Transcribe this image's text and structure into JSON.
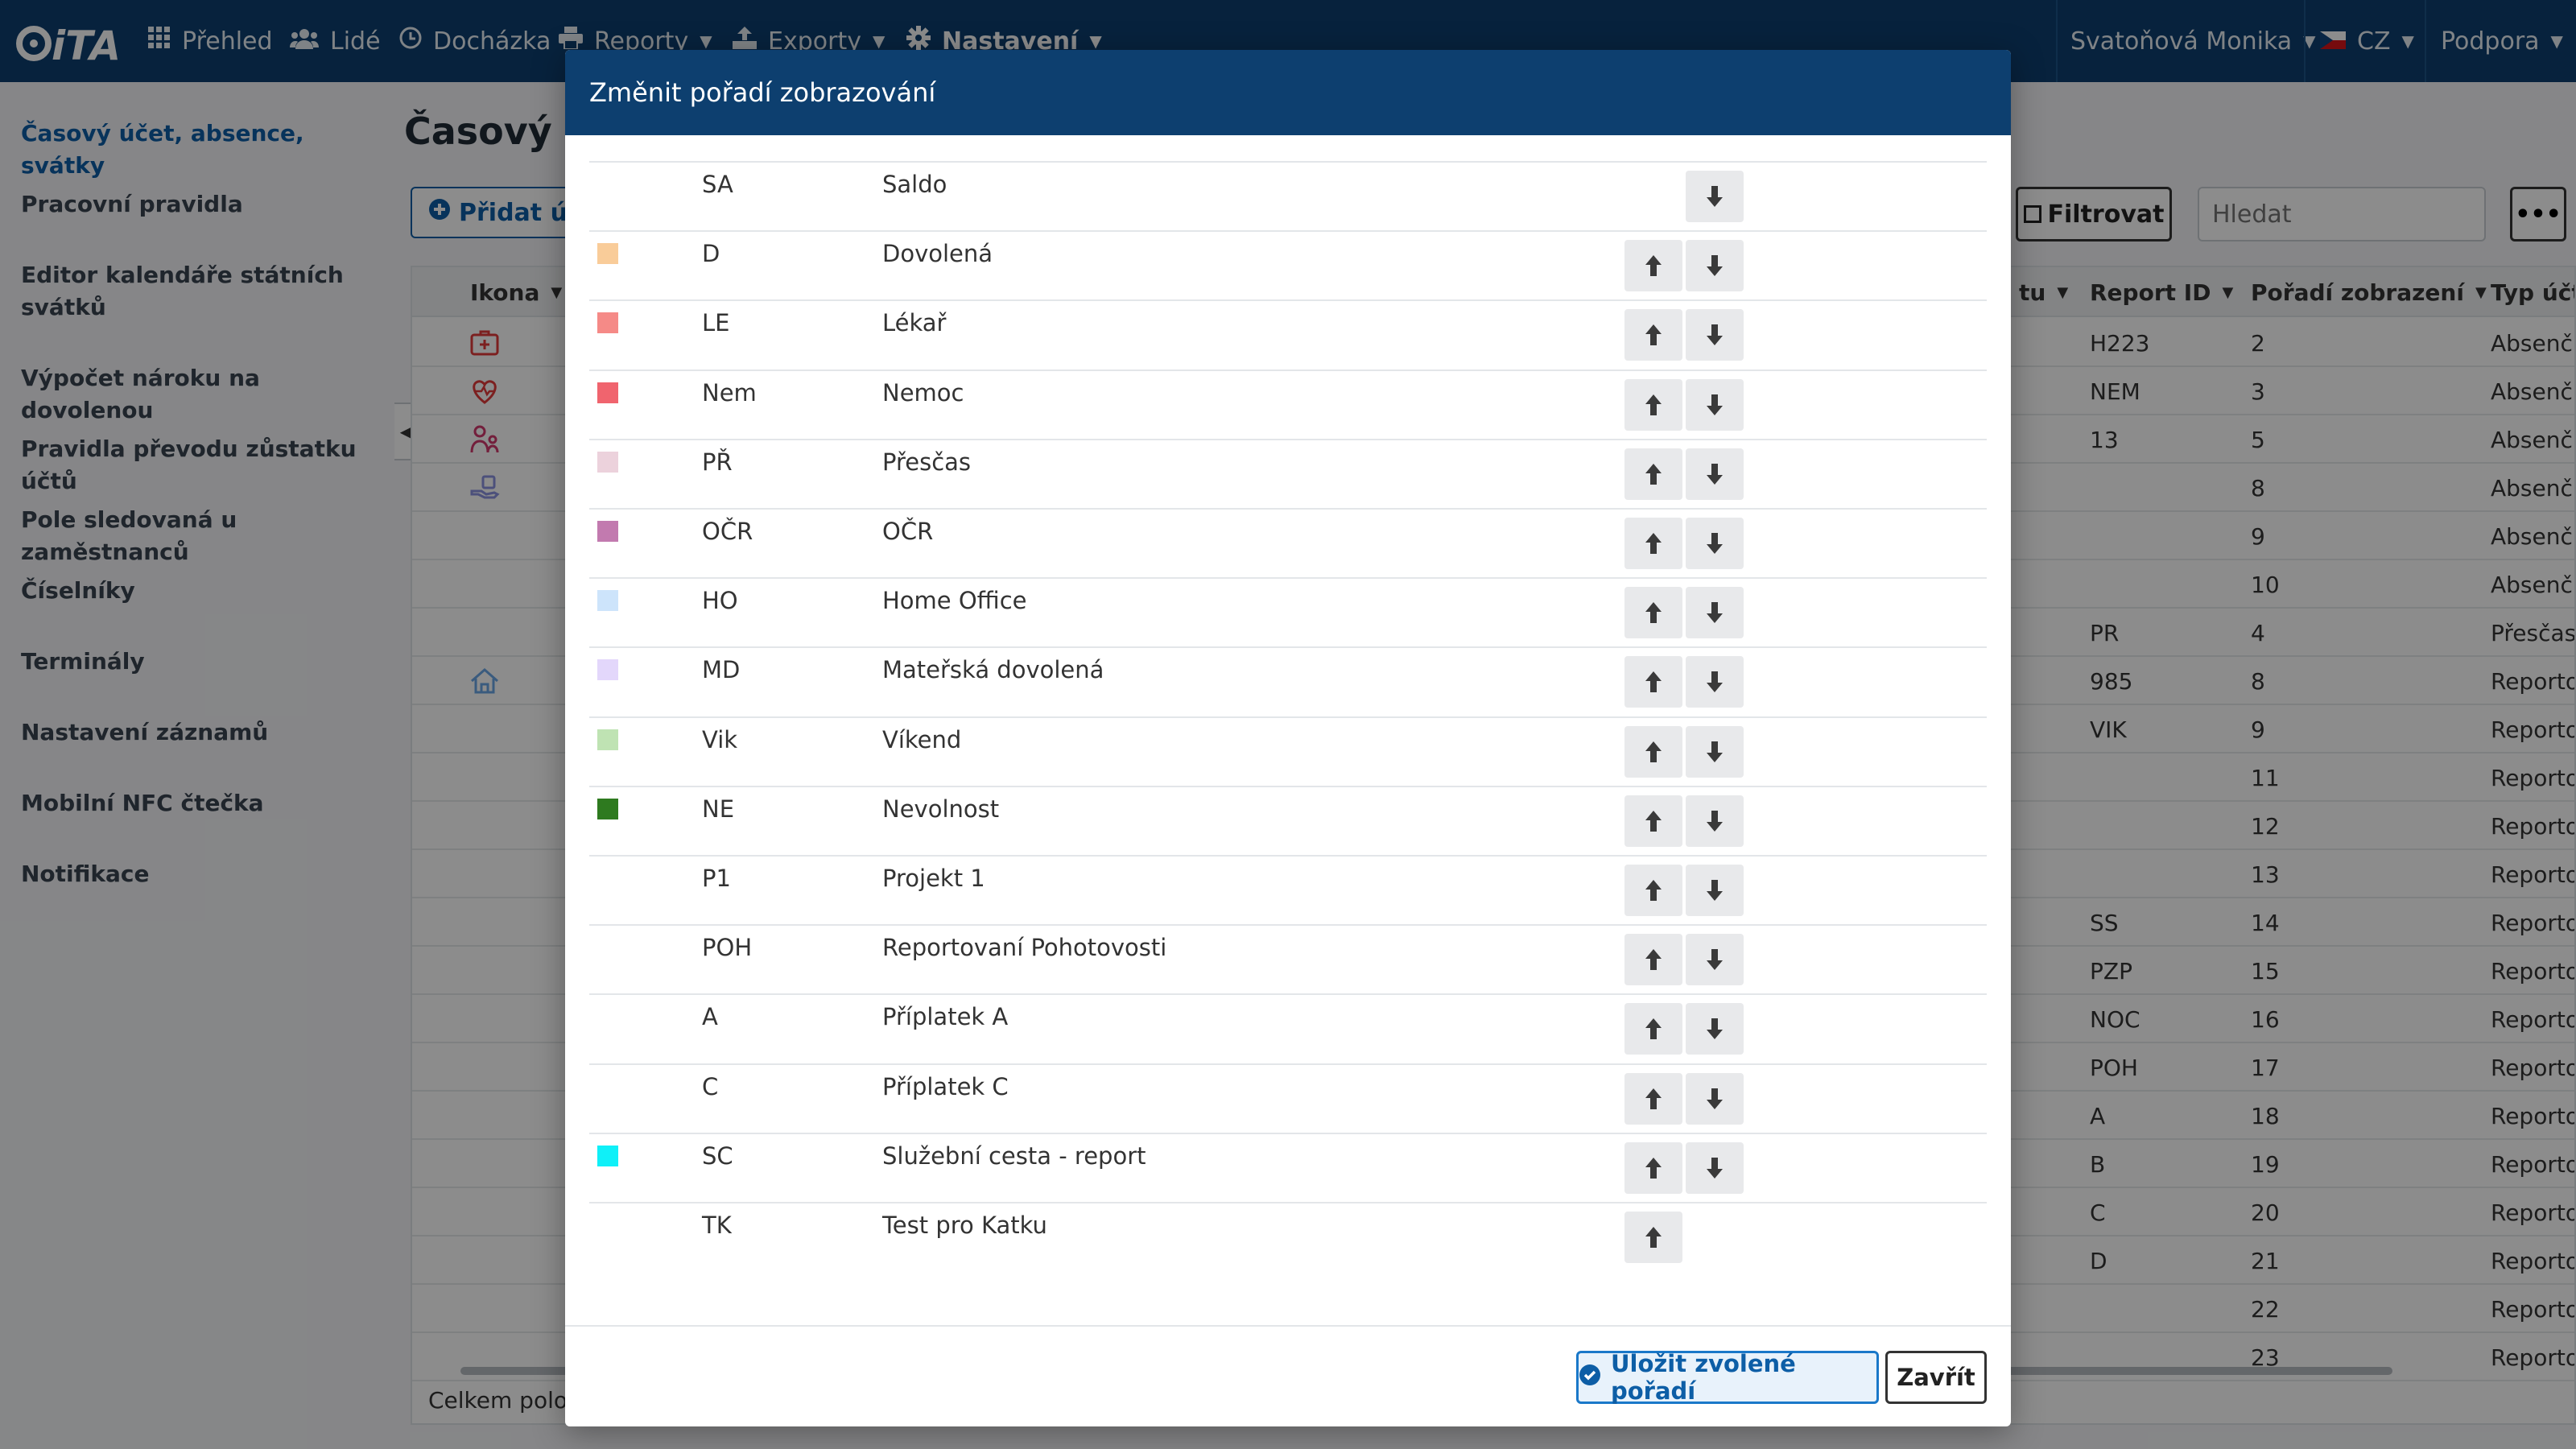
{
  "navbar": {
    "logo_text": "iTA",
    "items": [
      {
        "label": "Přehled",
        "icon": "grid-icon"
      },
      {
        "label": "Lidé",
        "icon": "users-icon"
      },
      {
        "label": "Docházka",
        "icon": "clock-icon"
      },
      {
        "label": "Reporty",
        "icon": "print-icon"
      },
      {
        "label": "Exporty",
        "icon": "export-icon"
      },
      {
        "label": "Nastavení",
        "icon": "gear-icon"
      }
    ],
    "user": "Svatoňová Monika",
    "language": "CZ",
    "support": "Podpora"
  },
  "sidebar": {
    "items": [
      {
        "label": "Časový účet, absence, svátky"
      },
      {
        "label": "Pracovní pravidla"
      },
      {
        "label": "Editor kalendáře státních svátků"
      },
      {
        "label": "Výpočet nároku na dovolenou"
      },
      {
        "label": "Pravidla převodu zůstatku účtů"
      },
      {
        "label": "Pole sledovaná u zaměstnanců"
      },
      {
        "label": "Číselníky"
      },
      {
        "label": "Terminály"
      },
      {
        "label": "Nastavení záznamů"
      },
      {
        "label": "Mobilní NFC čtečka"
      },
      {
        "label": "Notifikace"
      }
    ]
  },
  "main": {
    "title": "Časový úč",
    "add_button": "Přidat úč",
    "filter_button": "Filtrovat",
    "search_placeholder": "Hledat",
    "more_button": "•••",
    "columns": {
      "icon": "Ikona",
      "col_partial": "tu",
      "report_id": "Report ID",
      "display_order": "Pořadí zobrazení",
      "type": "Typ účt"
    },
    "rows": [
      {
        "report_id": "H223",
        "order": "2",
        "type": "Absenč"
      },
      {
        "report_id": "NEM",
        "order": "3",
        "type": "Absenč"
      },
      {
        "report_id": "13",
        "order": "5",
        "type": "Absenč"
      },
      {
        "report_id": "",
        "order": "8",
        "type": "Absenč"
      },
      {
        "report_id": "",
        "order": "9",
        "type": "Absenč"
      },
      {
        "report_id": "",
        "order": "10",
        "type": "Absenč"
      },
      {
        "report_id": "PR",
        "order": "4",
        "type": "Přesčas"
      },
      {
        "report_id": "985",
        "order": "8",
        "type": "Reporto"
      },
      {
        "report_id": "VIK",
        "order": "9",
        "type": "Reporto"
      },
      {
        "report_id": "",
        "order": "11",
        "type": "Reporto"
      },
      {
        "report_id": "",
        "order": "12",
        "type": "Reporto"
      },
      {
        "report_id": "",
        "order": "13",
        "type": "Reporto"
      },
      {
        "report_id": "SS",
        "order": "14",
        "type": "Reporto"
      },
      {
        "report_id": "PZP",
        "order": "15",
        "type": "Reporto"
      },
      {
        "report_id": "NOC",
        "order": "16",
        "type": "Reporto"
      },
      {
        "report_id": "POH",
        "order": "17",
        "type": "Reporto"
      },
      {
        "report_id": "A",
        "order": "18",
        "type": "Reporto"
      },
      {
        "report_id": "B",
        "order": "19",
        "type": "Reporto"
      },
      {
        "report_id": "C",
        "order": "20",
        "type": "Reporto"
      },
      {
        "report_id": "D",
        "order": "21",
        "type": "Reporto"
      },
      {
        "report_id": "",
        "order": "22",
        "type": "Reporto"
      },
      {
        "report_id": "",
        "order": "23",
        "type": "Reporto"
      }
    ],
    "footer": "Celkem polož"
  },
  "modal": {
    "title": "Změnit pořadí zobrazování",
    "rows": [
      {
        "code": "SA",
        "name": "Saldo",
        "color": "",
        "up": false,
        "down": true
      },
      {
        "code": "D",
        "name": "Dovolená",
        "color": "#f9cc99",
        "up": true,
        "down": true
      },
      {
        "code": "LE",
        "name": "Lékař",
        "color": "#f58a87",
        "up": true,
        "down": true
      },
      {
        "code": "Nem",
        "name": "Nemoc",
        "color": "#f0646e",
        "up": true,
        "down": true
      },
      {
        "code": "PŘ",
        "name": "Přesčas",
        "color": "#ecd2dc",
        "up": true,
        "down": true
      },
      {
        "code": "OČR",
        "name": "OČR",
        "color": "#c27aaf",
        "up": true,
        "down": true
      },
      {
        "code": "HO",
        "name": "Home Office",
        "color": "#cde4fb",
        "up": true,
        "down": true
      },
      {
        "code": "MD",
        "name": "Mateřská dovolená",
        "color": "#e3d7fb",
        "up": true,
        "down": true
      },
      {
        "code": "Vik",
        "name": "Víkend",
        "color": "#bfe3b3",
        "up": true,
        "down": true
      },
      {
        "code": "NE",
        "name": "Nevolnost",
        "color": "#2e7a1f",
        "up": true,
        "down": true
      },
      {
        "code": "P1",
        "name": "Projekt 1",
        "color": "",
        "up": true,
        "down": true
      },
      {
        "code": "POH",
        "name": "Reportovaní Pohotovosti",
        "color": "",
        "up": true,
        "down": true
      },
      {
        "code": "A",
        "name": "Příplatek A",
        "color": "",
        "up": true,
        "down": true
      },
      {
        "code": "C",
        "name": "Příplatek C",
        "color": "",
        "up": true,
        "down": true
      },
      {
        "code": "SC",
        "name": "Služební cesta - report",
        "color": "#0ff0f8",
        "up": true,
        "down": true
      },
      {
        "code": "TK",
        "name": "Test pro Katku",
        "color": "",
        "up": true,
        "down": false
      }
    ],
    "save_button": "Uložit zvolené pořadí",
    "close_button": "Zavřít"
  }
}
